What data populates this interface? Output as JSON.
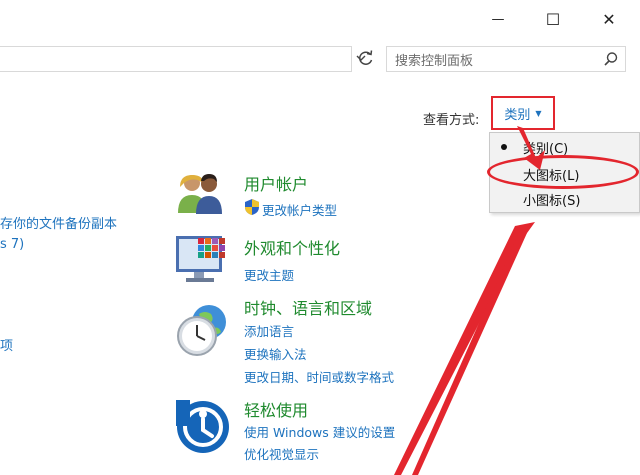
{
  "window": {
    "controls": {
      "minimize": "—",
      "maximize": "☐",
      "close": "✕"
    }
  },
  "search": {
    "placeholder": "搜索控制面板"
  },
  "view_by": {
    "label": "查看方式:",
    "selected": "类别",
    "options": [
      "类别(C)",
      "大图标(L)",
      "小图标(S)"
    ]
  },
  "left_fragments": [
    "存你的文件备份副本",
    "s 7)",
    "项"
  ],
  "categories": [
    {
      "title": "用户帐户",
      "links": [
        "更改帐户类型"
      ]
    },
    {
      "title": "外观和个性化",
      "links": [
        "更改主题"
      ]
    },
    {
      "title": "时钟、语言和区域",
      "links": [
        "添加语言",
        "更换输入法",
        "更改日期、时间或数字格式"
      ]
    },
    {
      "title": "轻松使用",
      "links": [
        "使用 Windows 建议的设置",
        "优化视觉显示"
      ]
    }
  ],
  "colors": {
    "link": "#1e73be",
    "category_title": "#1f8a2e",
    "annotation": "#e3262e"
  }
}
